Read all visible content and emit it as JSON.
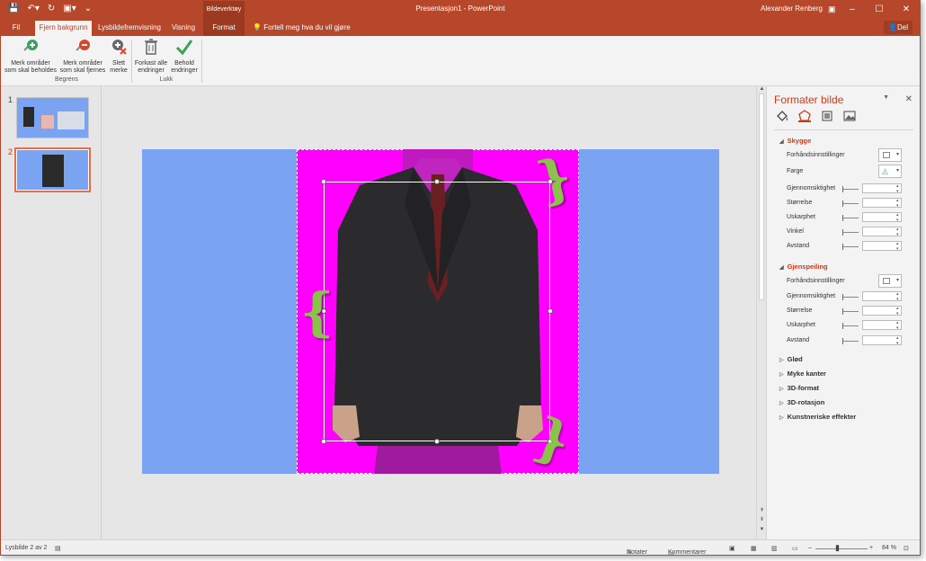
{
  "window": {
    "title": "Presentasjon1 - PowerPoint",
    "tools_context": "Bildeverktøy",
    "user": "Alexander Renberg"
  },
  "tabs": {
    "file": "Fil",
    "remove_bg": "Fjern bakgrunn",
    "slideshow": "Lysbildefremvisning",
    "view": "Visning",
    "format": "Format",
    "tell_me": "Fortell meg hva du vil gjøre",
    "share": "Del"
  },
  "ribbon": {
    "keep_line1": "Merk områder",
    "keep_line2": "som skal beholdes",
    "remove_line1": "Merk områder",
    "remove_line2": "som skal fjernes",
    "delete_line1": "Slett",
    "delete_line2": "merke",
    "discard_line1": "Forkast alle",
    "discard_line2": "endringer",
    "keep_changes_line1": "Behold",
    "keep_changes_line2": "endringer",
    "group_refine": "Begrens",
    "group_close": "Lukk"
  },
  "thumbnails": [
    {
      "number": "1"
    },
    {
      "number": "2"
    }
  ],
  "pane": {
    "title": "Formater bilde",
    "shadow": {
      "heading": "Skygge",
      "presets": "Forhåndsinnstillinger",
      "color": "Farge",
      "transparency": "Gjennomsiktighet",
      "size": "Størrelse",
      "blur": "Uskarphet",
      "angle": "Vinkel",
      "distance": "Avstand"
    },
    "reflection": {
      "heading": "Gjenspeiling",
      "presets": "Forhåndsinnstillinger",
      "transparency": "Gjennomsiktighet",
      "size": "Størrelse",
      "blur": "Uskarphet",
      "distance": "Avstand"
    },
    "collapsed": [
      "Glød",
      "Myke kanter",
      "3D-format",
      "3D-rotasjon",
      "Kunstneriske effekter"
    ]
  },
  "status": {
    "slide_info": "Lysbilde 2 av 2",
    "notes": "Notater",
    "comments": "Kommentarer",
    "zoom": "84 %"
  },
  "colors": {
    "accent": "#b7472a",
    "slide_bg": "#7aa4f2",
    "removal_overlay": "#ff00ff",
    "brace": "#8bc34a"
  }
}
